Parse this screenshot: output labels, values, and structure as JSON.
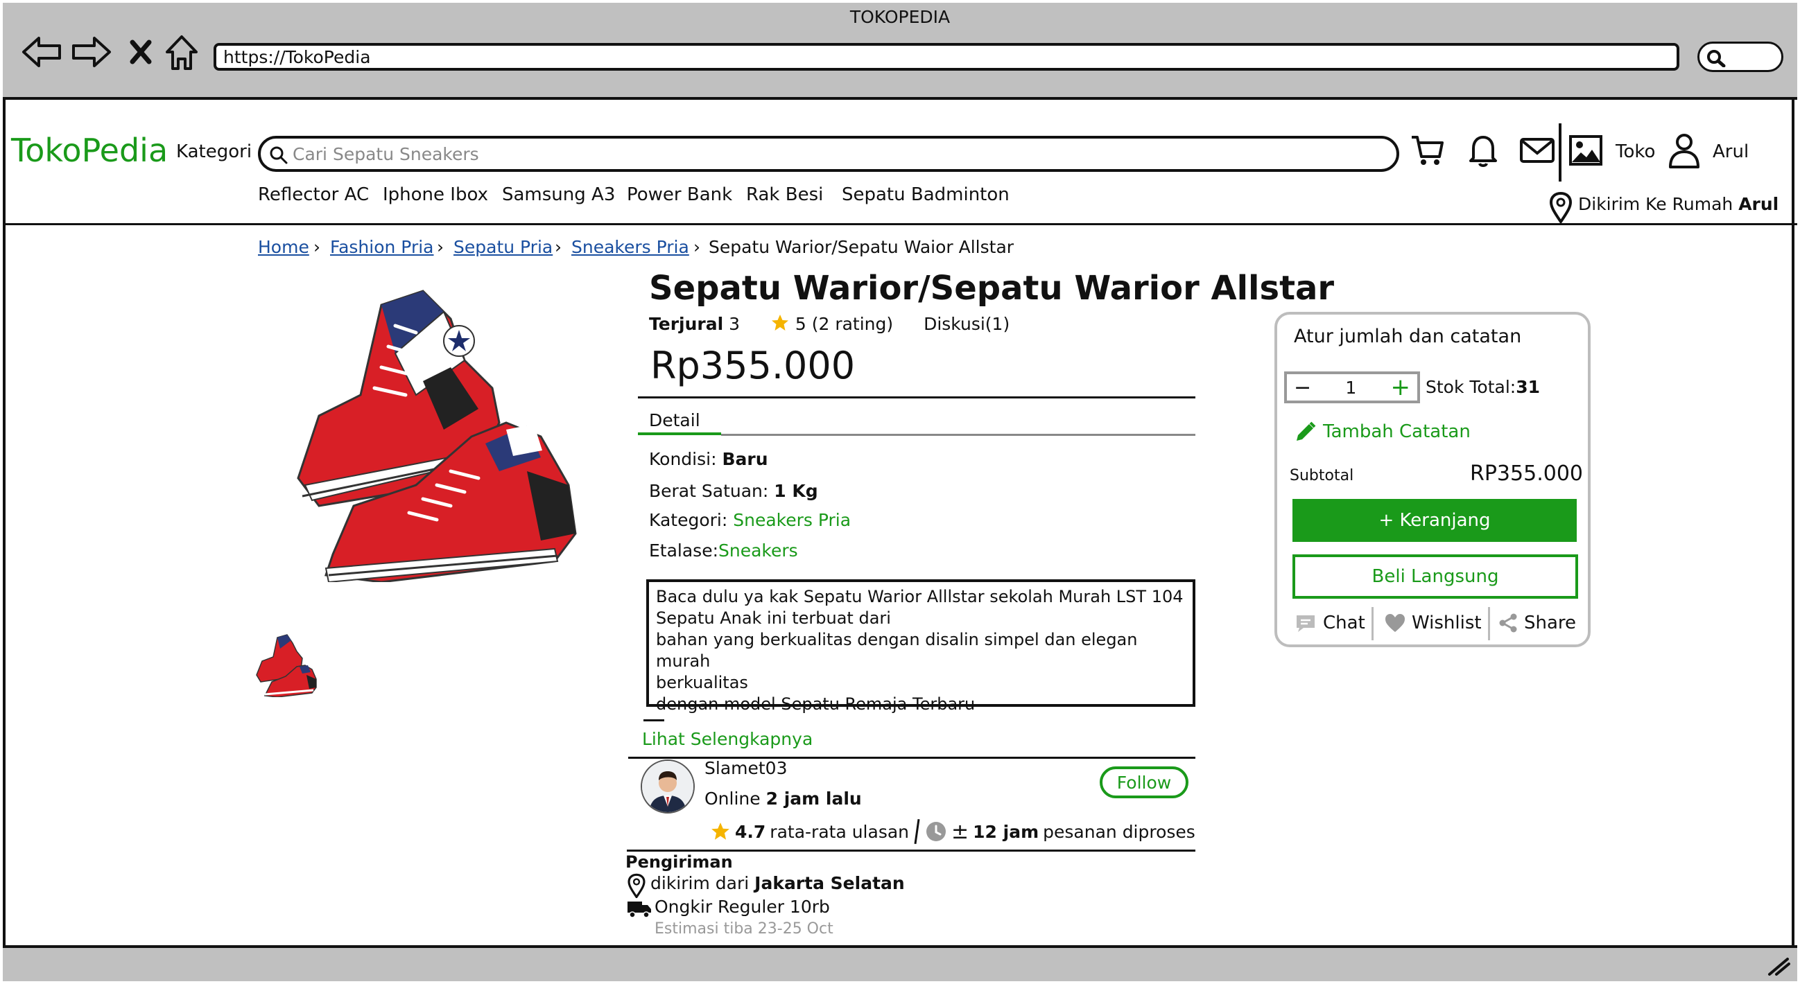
{
  "window": {
    "title": "TOKOPEDIA",
    "url": "https://TokoPedia"
  },
  "header": {
    "logo": "TokoPedia",
    "kategori": "Kategori",
    "search_placeholder": "Cari Sepatu Sneakers",
    "quick_links": [
      "Reflector AC",
      "Iphone Ibox",
      "Samsung A3",
      "Power Bank",
      "Rak Besi",
      "Sepatu Badminton"
    ],
    "toko": "Toko",
    "user": "Arul",
    "delivery_label": "Dikirim Ke Rumah",
    "delivery_user": "Arul"
  },
  "breadcrumb": [
    "Home",
    "Fashion Pria",
    "Sepatu Pria",
    "Sneakers Pria",
    "Sepatu Warior/Sepatu Waior Allstar"
  ],
  "product": {
    "title": "Sepatu Warior/Sepatu Warior Allstar",
    "sold_label": "Terjural",
    "sold_count": "3",
    "rating": "5 (2 rating)",
    "discussion": "Diskusi(1)",
    "price": "Rp355.000",
    "detail_tab": "Detail",
    "kondisi_label": "Kondisi:",
    "kondisi": "Baru",
    "berat_label": "Berat Satuan:",
    "berat": "1 Kg",
    "kategori_label": "Kategori:",
    "kategori": "Sneakers Pria",
    "etalase_label": "Etalase:",
    "etalase": "Sneakers",
    "description": [
      "Baca dulu ya kak Sepatu Warior Alllstar sekolah Murah LST 104",
      "Sepatu Anak ini terbuat dari",
      "bahan yang berkualitas dengan disalin simpel dan elegan murah",
      "berkualitas",
      "dengan model Sepatu Remaja Terbaru"
    ],
    "see_more": "Lihat Selengkapnya"
  },
  "shop": {
    "name": "Slamet03",
    "online_label": "Online",
    "online_time": "2 jam lalu",
    "follow": "Follow",
    "rating": "4.7",
    "rating_label": "rata-rata ulasan",
    "process_prefix": "±",
    "process_time": "12 jam",
    "process_label": "pesanan diproses"
  },
  "shipping": {
    "title": "Pengiriman",
    "from_label": "dikirim dari",
    "from": "Jakarta Selatan",
    "ongkir": "Ongkir Reguler 10rb",
    "estimate": "Estimasi tiba 23-25 Oct"
  },
  "panel": {
    "title": "Atur jumlah dan catatan",
    "qty": "1",
    "stock_label": "Stok Total:",
    "stock": "31",
    "note": "Tambah Catatan",
    "subtotal_label": "Subtotal",
    "subtotal": "RP355.000",
    "cart": "+ Keranjang",
    "buy": "Beli Langsung",
    "chat": "Chat",
    "wishlist": "Wishlist",
    "share": "Share"
  },
  "colors": {
    "accent": "#1a9a1a",
    "link": "#1a4fa0",
    "chrome": "#c0c0c0",
    "star": "#f5b400"
  }
}
